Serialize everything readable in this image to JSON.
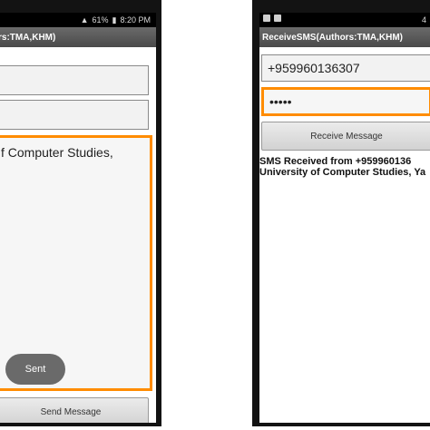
{
  "left_phone": {
    "status": {
      "left_icons": [
        "notification-icon",
        "settings-icon"
      ],
      "signal": "▲",
      "battery": "61%",
      "battery_icon": "▮",
      "time": "8:20 PM"
    },
    "title": "rs:TMA,KHM)",
    "message_text": "f Computer Studies,",
    "toast": "Sent",
    "send_button": "Send Message"
  },
  "right_phone": {
    "status": {
      "left_icons": [
        "photo-icon",
        "message-icon"
      ],
      "right_text": "4"
    },
    "title": "ReceiveSMS(Authors:TMA,KHM)",
    "phone_value": "+959960136307",
    "password_value": "•••••",
    "receive_button": "Receive Message",
    "received_line1": "SMS Received from +959960136",
    "received_line2": "University of Computer Studies, Ya"
  }
}
